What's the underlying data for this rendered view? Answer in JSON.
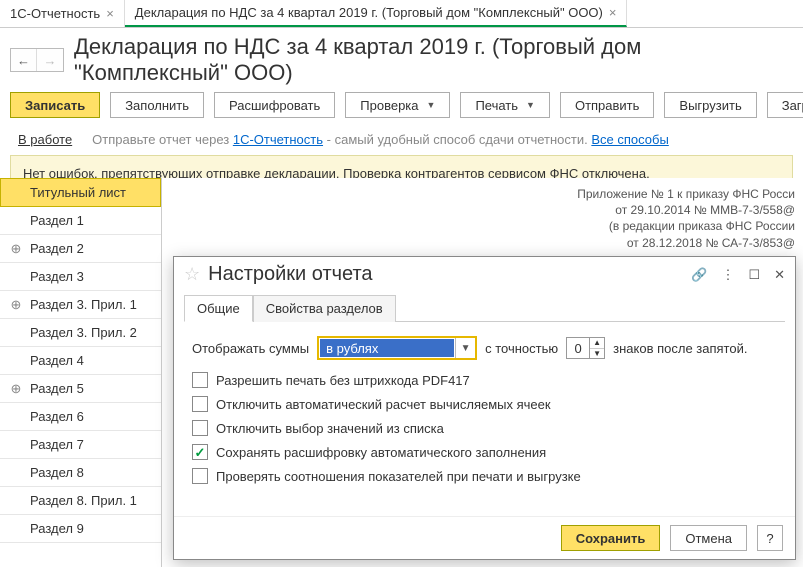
{
  "tabs": [
    {
      "label": "1С-Отчетность"
    },
    {
      "label": "Декларация по НДС за 4 квартал 2019 г. (Торговый дом \"Комплексный\" ООО)"
    }
  ],
  "header": {
    "title": "Декларация по НДС за 4 квартал 2019 г. (Торговый дом \"Комплексный\" ООО)"
  },
  "toolbar": {
    "save": "Записать",
    "fill": "Заполнить",
    "decode": "Расшифровать",
    "check": "Проверка",
    "print": "Печать",
    "send": "Отправить",
    "upload": "Выгрузить",
    "download": "Загрузить"
  },
  "status": {
    "label": "В работе",
    "hint_pre": "Отправьте отчет через ",
    "hint_link": "1С-Отчетность",
    "hint_post": " - самый удобный способ сдачи отчетности. ",
    "hint_all": "Все способы"
  },
  "infobar": "Нет ошибок, препятствующих отправке декларации. Проверка контрагентов сервисом ФНС отключена.",
  "sidebar": {
    "items": [
      {
        "label": "Титульный лист",
        "exp": ""
      },
      {
        "label": "Раздел 1",
        "exp": ""
      },
      {
        "label": "Раздел 2",
        "exp": "⊕"
      },
      {
        "label": "Раздел 3",
        "exp": ""
      },
      {
        "label": "Раздел 3. Прил. 1",
        "exp": "⊕"
      },
      {
        "label": "Раздел 3. Прил. 2",
        "exp": ""
      },
      {
        "label": "Раздел 4",
        "exp": ""
      },
      {
        "label": "Раздел 5",
        "exp": "⊕"
      },
      {
        "label": "Раздел 6",
        "exp": ""
      },
      {
        "label": "Раздел 7",
        "exp": ""
      },
      {
        "label": "Раздел 8",
        "exp": ""
      },
      {
        "label": "Раздел 8. Прил. 1",
        "exp": ""
      },
      {
        "label": "Раздел 9",
        "exp": ""
      }
    ]
  },
  "docmeta": {
    "l1": "Приложение № 1 к приказу ФНС Росси",
    "l2": "от 29.10.2014 № ММВ-7-3/558@",
    "l3": "(в редакции приказа ФНС России",
    "l4": "от 28.12.2018 № СА-7-3/853@"
  },
  "dialog": {
    "title": "Настройки отчета",
    "tabs": {
      "general": "Общие",
      "sections": "Свойства разделов"
    },
    "display_label": "Отображать суммы",
    "display_value": "в рублях",
    "precision_label": "с точностью",
    "precision_value": "0",
    "precision_suffix": "знаков после запятой.",
    "cb_barcode": "Разрешить печать без штрихкода PDF417",
    "cb_autocalc": "Отключить автоматический расчет вычисляемых ячеек",
    "cb_listsel": "Отключить выбор значений из списка",
    "cb_keepdec": "Сохранять расшифровку автоматического заполнения",
    "cb_checkrel": "Проверять соотношения показателей при печати и выгрузке",
    "save": "Сохранить",
    "cancel": "Отмена",
    "help": "?"
  }
}
